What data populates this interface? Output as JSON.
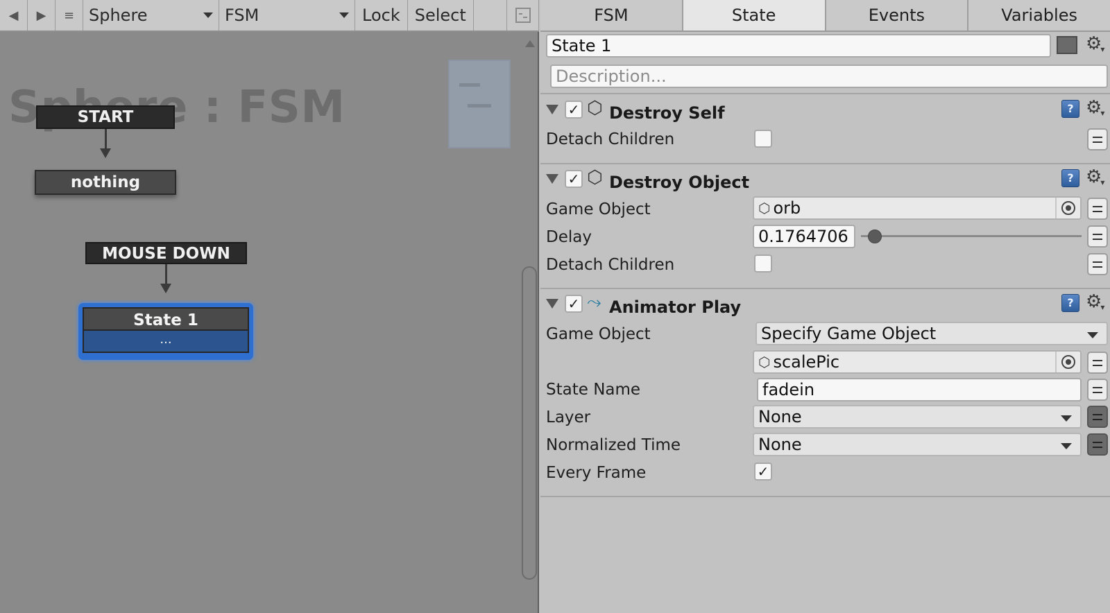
{
  "toolbar": {
    "prev_icon": "◀",
    "next_icon": "▶",
    "menu_icon": "≡",
    "gameobject": "Sphere",
    "fsm": "FSM",
    "lock_label": "Lock",
    "select_label": "Select"
  },
  "graph": {
    "watermark": "Sphere : FSM",
    "start_event": "START",
    "start_state": "nothing",
    "mouse_event": "MOUSE DOWN",
    "selected_state": "State 1",
    "selected_state_actions": "..."
  },
  "inspector": {
    "tabs": [
      {
        "label": "FSM"
      },
      {
        "label": "State"
      },
      {
        "label": "Events"
      },
      {
        "label": "Variables"
      }
    ],
    "active_tab": "State",
    "state_name": "State 1",
    "description_placeholder": "Description...",
    "actions": [
      {
        "title": "Destroy Self",
        "enabled": true,
        "fields": [
          {
            "label": "Detach Children",
            "type": "checkbox",
            "checked": false
          }
        ]
      },
      {
        "title": "Destroy Object",
        "enabled": true,
        "fields": [
          {
            "label": "Game Object",
            "type": "object",
            "value": "orb"
          },
          {
            "label": "Delay",
            "type": "slider",
            "value": "0.1764706",
            "fraction": 0.0
          },
          {
            "label": "Detach Children",
            "type": "checkbox",
            "checked": false
          }
        ]
      },
      {
        "title": "Animator Play",
        "enabled": true,
        "fields": [
          {
            "label": "Game Object",
            "type": "dropdown",
            "value": "Specify Game Object"
          },
          {
            "label": "",
            "type": "object",
            "value": "scalePic"
          },
          {
            "label": "State Name",
            "type": "text",
            "value": "fadein"
          },
          {
            "label": "Layer",
            "type": "dropdown",
            "value": "None"
          },
          {
            "label": "Normalized Time",
            "type": "dropdown",
            "value": "None"
          },
          {
            "label": "Every Frame",
            "type": "checkbox",
            "checked": true
          }
        ]
      }
    ]
  },
  "colors": {
    "graph_bg": "#8a8a8a",
    "inspector_bg": "#c2c2c2",
    "selection": "#2f6fd0",
    "help_icon": "#3c6cb0"
  },
  "icons": {
    "cube": "cube-icon",
    "gear": "gear-icon",
    "help": "help-book-icon",
    "animator": "animator-icon",
    "picker": "object-picker-icon"
  }
}
